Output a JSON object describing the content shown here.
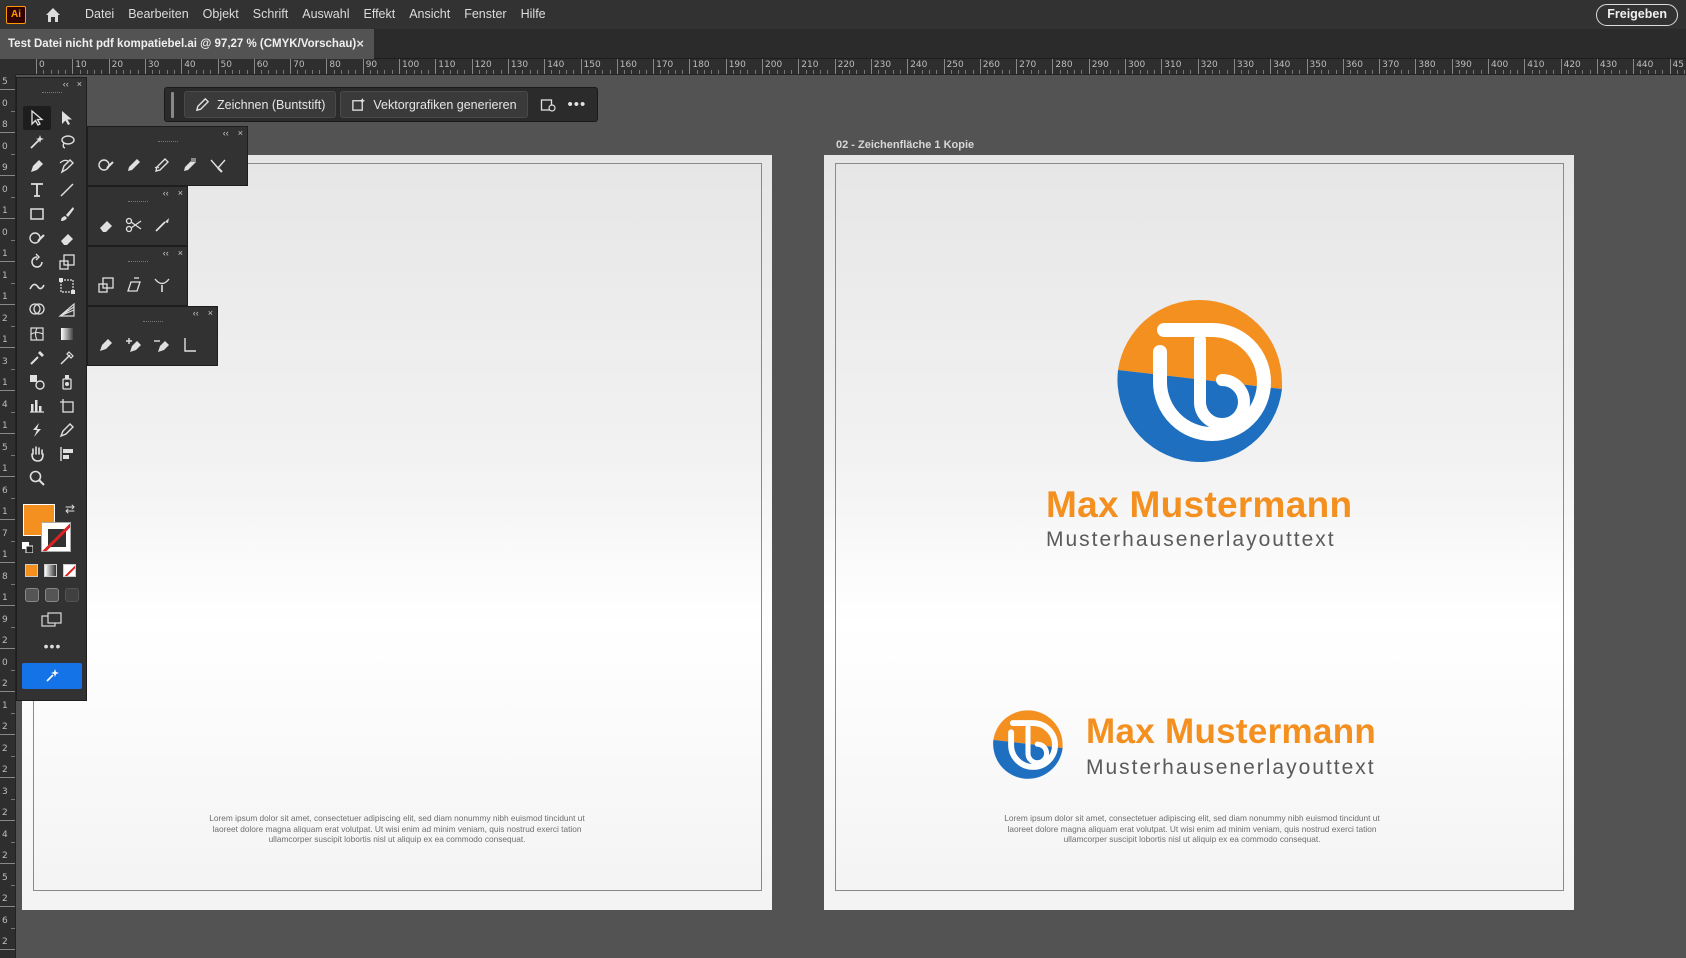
{
  "app": {
    "logo_text": "Ai"
  },
  "menu": [
    "Datei",
    "Bearbeiten",
    "Objekt",
    "Schrift",
    "Auswahl",
    "Effekt",
    "Ansicht",
    "Fenster",
    "Hilfe"
  ],
  "share_label": "Freigeben",
  "tab": {
    "title": "Test Datei nicht pdf kompatiebel.ai @ 97,27 % (CMYK/Vorschau)",
    "close": "×"
  },
  "ruler": {
    "h_labels": [
      "0",
      "10",
      "20",
      "30",
      "40",
      "50",
      "60",
      "70",
      "80",
      "90",
      "100",
      "110",
      "120",
      "130",
      "140",
      "150",
      "160",
      "170",
      "180",
      "190",
      "200",
      "210",
      "220",
      "230",
      "240",
      "250",
      "260",
      "270",
      "280",
      "290",
      "300",
      "310",
      "320",
      "330",
      "340",
      "350",
      "360",
      "370",
      "380",
      "390",
      "400",
      "410",
      "420",
      "430",
      "440",
      "45"
    ],
    "v_labels": [
      "5",
      "0",
      "8",
      "0",
      "9",
      "0",
      "1",
      "0",
      "1",
      "1",
      "1",
      "2",
      "1",
      "3",
      "1",
      "4",
      "1",
      "5",
      "1",
      "6",
      "1",
      "7",
      "1",
      "8",
      "1",
      "9",
      "2",
      "0",
      "2",
      "1",
      "2",
      "2",
      "2",
      "3",
      "2",
      "4",
      "2",
      "5",
      "2",
      "6",
      "2",
      "7"
    ]
  },
  "context_bar": {
    "draw_label": "Zeichnen (Buntstift)",
    "vector_label": "Vektorgrafiken generieren",
    "more": "•••"
  },
  "toolbar": {
    "more": "•••",
    "collapse": "‹‹",
    "close": "×"
  },
  "artboard2_label": "02 - Zeichenfläche 1 Kopie",
  "brand": {
    "name": "Max Mustermann",
    "tagline": "Musterhausenerlayouttext"
  },
  "colors": {
    "orange": "#f39020",
    "blue": "#1e6fc0"
  },
  "lorem": {
    "line1": "Lorem ipsum dolor sit amet, consectetuer adipiscing elit, sed diam nonummy nibh euismod tincidunt ut",
    "line2": "laoreet dolore magna aliquam erat volutpat. Ut wisi enim ad minim veniam, quis nostrud exerci tation",
    "line3": "ullamcorper suscipit lobortis nisl ut aliquip ex ea commodo consequat."
  }
}
